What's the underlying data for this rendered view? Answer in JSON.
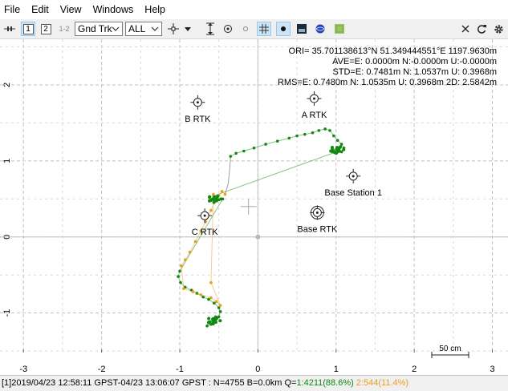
{
  "menu": [
    "File",
    "Edit",
    "View",
    "Windows",
    "Help"
  ],
  "toolbar": {
    "btn1": "1",
    "btn2": "2",
    "btn12": "1-2",
    "plot_type": "Gnd Trk",
    "quality_filter": "ALL"
  },
  "info": {
    "line1": "ORI= 35.701138613°N   51.349444551°E 1197.9630m",
    "line2": "AVE=E: 0.0000m N:-0.0000m U:-0.0000m",
    "line3": "STD=E: 0.7481m N: 1.0537m U: 0.3968m",
    "line4": "RMS=E: 0.7480m N: 1.0535m U: 0.3968m 2D: 2.5842m"
  },
  "scale_label": "50 cm",
  "colors": {
    "fix": "#118811",
    "float": "#e8a020",
    "grid": "#c0c0c0",
    "axis": "#c0c0c0"
  },
  "chart_data": {
    "type": "scatter",
    "xlim": [
      -3.3,
      3.2
    ],
    "ylim": [
      -1.52,
      2.6
    ],
    "xticks": [
      -3,
      -2,
      -1,
      0,
      1,
      2,
      3
    ],
    "yticks": [
      -1,
      0,
      1,
      2
    ],
    "grid": true,
    "markers": [
      {
        "label": "B RTK",
        "x": -0.77,
        "y": 1.77
      },
      {
        "label": "A RTK",
        "x": 0.72,
        "y": 1.82
      },
      {
        "label": "Base Station 1",
        "x": 1.22,
        "y": 0.8
      },
      {
        "label": "C RTK",
        "x": -0.68,
        "y": 0.28
      },
      {
        "label": "Base RTK",
        "x": 0.76,
        "y": 0.32
      }
    ],
    "series": [
      {
        "name": "Q=1",
        "points": [
          [
            -0.35,
            1.06
          ],
          [
            -0.28,
            1.1
          ],
          [
            -0.18,
            1.13
          ],
          [
            -0.05,
            1.17
          ],
          [
            0.1,
            1.22
          ],
          [
            0.25,
            1.26
          ],
          [
            0.4,
            1.3
          ],
          [
            0.5,
            1.33
          ],
          [
            0.6,
            1.35
          ],
          [
            0.7,
            1.37
          ],
          [
            0.78,
            1.4
          ],
          [
            0.86,
            1.42
          ],
          [
            0.92,
            1.4
          ],
          [
            0.97,
            1.33
          ],
          [
            1.02,
            1.27
          ],
          [
            1.07,
            1.22
          ],
          [
            1.1,
            1.17
          ],
          [
            1.07,
            1.12
          ],
          [
            1.0,
            1.1
          ],
          [
            0.93,
            1.13
          ],
          [
            0.95,
            1.16
          ],
          [
            1.02,
            1.15
          ],
          [
            0.98,
            1.11
          ],
          [
            -0.62,
            0.52
          ],
          [
            -0.58,
            0.5
          ],
          [
            -0.55,
            0.52
          ],
          [
            -0.5,
            0.49
          ],
          [
            -0.45,
            0.5
          ],
          [
            -1.0,
            -0.45
          ],
          [
            -1.02,
            -0.52
          ],
          [
            -0.99,
            -0.6
          ],
          [
            -0.93,
            -0.66
          ],
          [
            -0.85,
            -0.7
          ],
          [
            -0.78,
            -0.74
          ],
          [
            -0.7,
            -0.79
          ],
          [
            -0.63,
            -0.82
          ],
          [
            -0.56,
            -0.87
          ],
          [
            -0.5,
            -0.93
          ],
          [
            -0.48,
            -0.98
          ],
          [
            -0.5,
            -1.05
          ],
          [
            -0.55,
            -1.11
          ],
          [
            -0.6,
            -1.15
          ],
          [
            -0.65,
            -1.17
          ],
          [
            -0.63,
            -1.12
          ],
          [
            -0.58,
            -1.08
          ],
          [
            -0.54,
            -1.05
          ]
        ],
        "color": "#118811"
      },
      {
        "name": "Q=2",
        "points": [
          [
            -0.42,
            0.56
          ],
          [
            -0.46,
            0.6
          ],
          [
            -0.5,
            0.55
          ],
          [
            -0.56,
            0.45
          ],
          [
            -0.6,
            0.35
          ],
          [
            -0.67,
            0.2
          ],
          [
            -0.73,
            0.08
          ],
          [
            -0.8,
            -0.06
          ],
          [
            -0.87,
            -0.2
          ],
          [
            -0.93,
            -0.3
          ],
          [
            -0.98,
            -0.38
          ],
          [
            -0.95,
            -0.68
          ],
          [
            -0.83,
            -0.72
          ],
          [
            -0.73,
            -0.76
          ],
          [
            -0.6,
            -0.8
          ],
          [
            -0.53,
            -0.85
          ],
          [
            -0.48,
            -0.9
          ],
          [
            -0.6,
            -0.6
          ],
          [
            -0.57,
            0.56
          ],
          [
            -0.53,
            0.47
          ]
        ],
        "color": "#e8a020"
      }
    ]
  },
  "status": {
    "prefix": "[1]2019/04/23 12:58:11 GPST-04/23 13:06:07 GPST : N=4755 B=0.0km Q=",
    "q1": "1:4211(88.6%)",
    "q2": "2:544(11.4%)"
  }
}
